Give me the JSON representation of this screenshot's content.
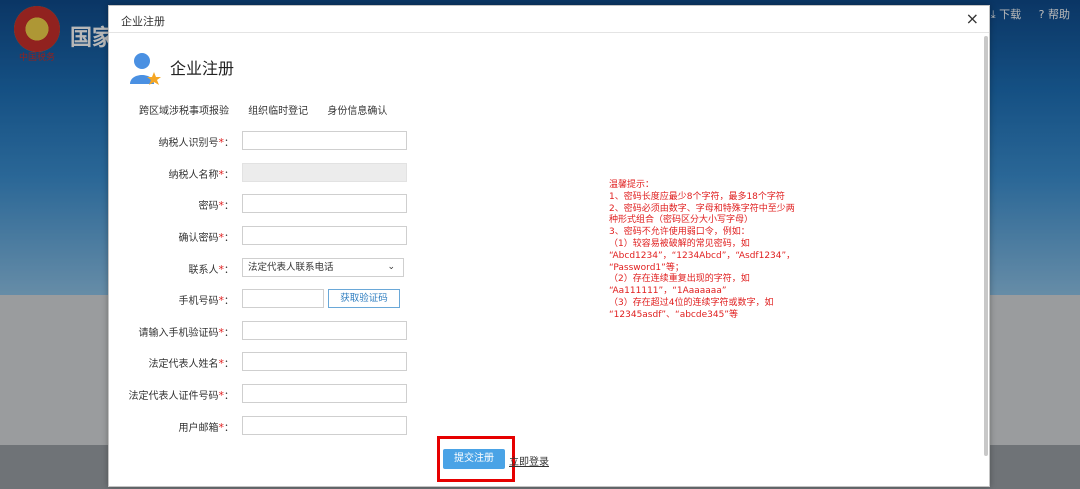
{
  "background": {
    "brand": "国家",
    "emblem_text": "中国税务",
    "nav": [
      "下载",
      "帮助"
    ]
  },
  "modal": {
    "title": "企业注册",
    "close": "×",
    "heading": "企业注册",
    "tabs": [
      "跨区域涉税事项报验",
      "组织临时登记",
      "身份信息确认"
    ],
    "fields": [
      {
        "label": "纳税人识别号",
        "required": "*",
        "value": ""
      },
      {
        "label": "纳税人名称",
        "required": "*",
        "value": ""
      },
      {
        "label": "密码",
        "required": "*",
        "value": ""
      },
      {
        "label": "确认密码",
        "required": "*",
        "value": ""
      },
      {
        "label": "联系人",
        "required": "*",
        "value": "法定代表人联系电话"
      },
      {
        "label": "手机号码",
        "required": "*",
        "value": ""
      },
      {
        "label": "请输入手机验证码",
        "required": "*",
        "value": ""
      },
      {
        "label": "法定代表人姓名",
        "required": "*",
        "value": ""
      },
      {
        "label": "法定代表人证件号码",
        "required": "*",
        "value": ""
      },
      {
        "label": "用户邮箱",
        "required": "*",
        "value": ""
      }
    ],
    "label_suffix": "：",
    "sms_button": "获取验证码",
    "tips": [
      "温馨提示：",
      "1、密码长度应最少8个字符，最多18个字符",
      "2、密码必须由数字、字母和特殊字符中至少两",
      "种形式组合（密码区分大小写字母）",
      "3、密码不允许使用弱口令，例如：",
      "（1）较容易被破解的常见密码，如",
      "“Abcd1234”，“1234Abcd”，“Asdf1234”，",
      "“Password1”等；",
      "（2）存在连续重复出现的字符，如",
      "“Aa111111”，“1Aaaaaaa”",
      "（3）存在超过4位的连续字符或数字，如",
      "“12345asdf”、“abcde345”等"
    ],
    "submit": "提交注册",
    "login_link": "立即登录"
  },
  "colors": {
    "accent": "#4aa3e6",
    "required": "#e02020",
    "highlight": "#e60000"
  }
}
